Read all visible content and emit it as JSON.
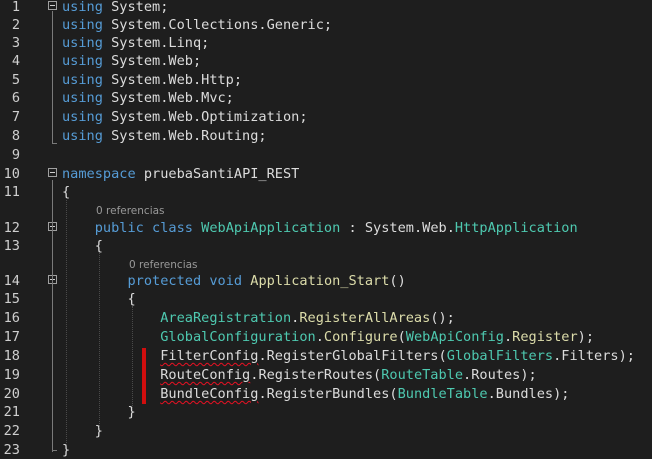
{
  "editor": {
    "lines": [
      {
        "n": "1",
        "tokens": [
          [
            "kw",
            "using"
          ],
          [
            "pl",
            " "
          ],
          [
            "pl",
            "System"
          ],
          [
            "pl",
            ";"
          ]
        ]
      },
      {
        "n": "2",
        "tokens": [
          [
            "kw",
            "using"
          ],
          [
            "pl",
            " System.Collections.Generic;"
          ]
        ]
      },
      {
        "n": "3",
        "tokens": [
          [
            "kw",
            "using"
          ],
          [
            "pl",
            " System.Linq;"
          ]
        ]
      },
      {
        "n": "4",
        "tokens": [
          [
            "kw",
            "using"
          ],
          [
            "pl",
            " System.Web;"
          ]
        ]
      },
      {
        "n": "5",
        "tokens": [
          [
            "kw",
            "using"
          ],
          [
            "pl",
            " System.Web.Http;"
          ]
        ]
      },
      {
        "n": "6",
        "tokens": [
          [
            "kw",
            "using"
          ],
          [
            "pl",
            " System.Web.Mvc;"
          ]
        ]
      },
      {
        "n": "7",
        "tokens": [
          [
            "kw",
            "using"
          ],
          [
            "pl",
            " System.Web.Optimization;"
          ]
        ]
      },
      {
        "n": "8",
        "tokens": [
          [
            "kw",
            "using"
          ],
          [
            "pl",
            " System.Web.Routing;"
          ]
        ]
      },
      {
        "n": "9",
        "tokens": []
      },
      {
        "n": "10",
        "tokens": [
          [
            "kw",
            "namespace"
          ],
          [
            "pl",
            " pruebaSantiAPI_REST"
          ]
        ]
      },
      {
        "n": "11",
        "tokens": [
          [
            "pl",
            "{"
          ]
        ]
      },
      {
        "n": "12",
        "tokens": [
          [
            "pl",
            "    "
          ],
          [
            "kw",
            "public"
          ],
          [
            "pl",
            " "
          ],
          [
            "kw",
            "class"
          ],
          [
            "pl",
            " "
          ],
          [
            "ty",
            "WebApiApplication"
          ],
          [
            "pl",
            " : System.Web."
          ],
          [
            "ty",
            "HttpApplication"
          ]
        ]
      },
      {
        "n": "13",
        "tokens": [
          [
            "pl",
            "    {"
          ]
        ]
      },
      {
        "n": "14",
        "tokens": [
          [
            "pl",
            "        "
          ],
          [
            "kw",
            "protected"
          ],
          [
            "pl",
            " "
          ],
          [
            "kw",
            "void"
          ],
          [
            "pl",
            " "
          ],
          [
            "fn",
            "Application_Start"
          ],
          [
            "pl",
            "()"
          ]
        ]
      },
      {
        "n": "15",
        "tokens": [
          [
            "pl",
            "        {"
          ]
        ]
      },
      {
        "n": "16",
        "tokens": [
          [
            "pl",
            "            "
          ],
          [
            "ty",
            "AreaRegistration"
          ],
          [
            "pl",
            "."
          ],
          [
            "fn",
            "RegisterAllAreas"
          ],
          [
            "pl",
            "();"
          ]
        ]
      },
      {
        "n": "17",
        "tokens": [
          [
            "pl",
            "            "
          ],
          [
            "ty",
            "GlobalConfiguration"
          ],
          [
            "pl",
            "."
          ],
          [
            "fn",
            "Configure"
          ],
          [
            "pl",
            "("
          ],
          [
            "ty",
            "WebApiConfig"
          ],
          [
            "pl",
            "."
          ],
          [
            "fn",
            "Register"
          ],
          [
            "pl",
            ");"
          ]
        ]
      },
      {
        "n": "18",
        "tokens": [
          [
            "pl",
            "            "
          ],
          [
            "pl",
            "FilterConfig",
            "squig"
          ],
          [
            "pl",
            "."
          ],
          [
            "pl",
            "RegisterGlobalFilters"
          ],
          [
            "pl",
            "("
          ],
          [
            "ty",
            "GlobalFilters"
          ],
          [
            "pl",
            "."
          ],
          [
            "pl",
            "Filters"
          ],
          [
            "pl",
            ");"
          ]
        ]
      },
      {
        "n": "19",
        "tokens": [
          [
            "pl",
            "            "
          ],
          [
            "pl",
            "RouteConfig",
            "squig"
          ],
          [
            "pl",
            "."
          ],
          [
            "pl",
            "RegisterRoutes"
          ],
          [
            "pl",
            "("
          ],
          [
            "ty",
            "RouteTable"
          ],
          [
            "pl",
            "."
          ],
          [
            "pl",
            "Routes"
          ],
          [
            "pl",
            ");"
          ]
        ]
      },
      {
        "n": "20",
        "tokens": [
          [
            "pl",
            "            "
          ],
          [
            "pl",
            "BundleConfig",
            "squig"
          ],
          [
            "pl",
            "."
          ],
          [
            "pl",
            "RegisterBundles"
          ],
          [
            "pl",
            "("
          ],
          [
            "ty",
            "BundleTable"
          ],
          [
            "pl",
            "."
          ],
          [
            "pl",
            "Bundles"
          ],
          [
            "pl",
            ");"
          ]
        ]
      },
      {
        "n": "21",
        "tokens": [
          [
            "pl",
            "        }"
          ]
        ]
      },
      {
        "n": "22",
        "tokens": [
          [
            "pl",
            "    }"
          ]
        ]
      },
      {
        "n": "23",
        "tokens": [
          [
            "pl",
            "}"
          ]
        ]
      }
    ],
    "codelens": [
      {
        "before_line": "12",
        "text": "0 referencias"
      },
      {
        "before_line": "14",
        "text": "0 referencias"
      }
    ],
    "fold_markers": [
      "1",
      "10",
      "12",
      "14"
    ]
  }
}
